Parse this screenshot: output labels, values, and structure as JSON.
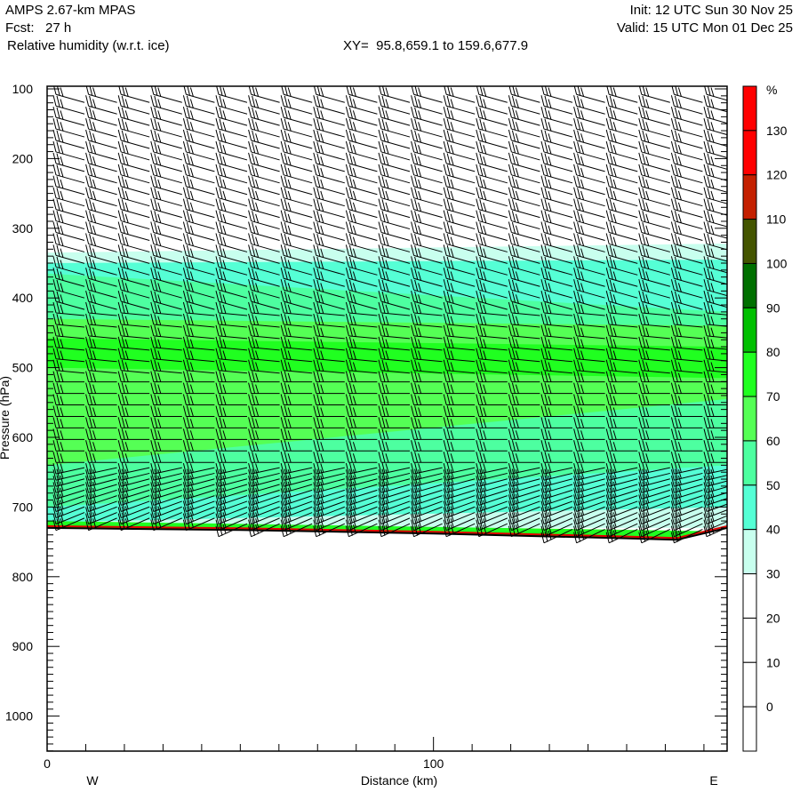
{
  "header": {
    "model": "AMPS 2.67-km MPAS",
    "forecast": "Fcst:   27 h",
    "field": "Relative humidity (w.r.t. ice)",
    "xy": "XY=  95.8,659.1 to 159.6,677.9",
    "init": "Init: 12 UTC Sun 30 Nov 25",
    "valid": "Valid: 15 UTC Mon 01 Dec 25"
  },
  "chart_data": {
    "type": "heatmap",
    "title": "Relative humidity (w.r.t. ice)",
    "xlabel": "Distance (km)",
    "ylabel": "Pressure (hPa)",
    "xlim": [
      0,
      176
    ],
    "ylim": [
      1050,
      96
    ],
    "x_ticks": [
      "0",
      "100"
    ],
    "x_tick_values": [
      0,
      100
    ],
    "y_ticks": [
      "100",
      "200",
      "300",
      "400",
      "500",
      "600",
      "700",
      "800",
      "900",
      "1000"
    ],
    "y_tick_values": [
      100,
      200,
      300,
      400,
      500,
      600,
      700,
      800,
      900,
      1000
    ],
    "west_label": "W",
    "east_label": "E",
    "colorbar": {
      "unit": "%",
      "labels": [
        "130",
        "120",
        "110",
        "100",
        "90",
        "80",
        "70",
        "60",
        "50",
        "40",
        "30",
        "20",
        "10",
        "0"
      ],
      "colors": [
        "#ff0000",
        "#ff0000",
        "#c42000",
        "#445500",
        "#007000",
        "#00c000",
        "#20ff20",
        "#55ff55",
        "#4dffa0",
        "#55ffd5",
        "#c8ffee",
        "#ffffff",
        "#ffffff",
        "#ffffff",
        "#ffffff"
      ]
    },
    "rh_layers": [
      {
        "bin": "30-40",
        "color": "#c8ffee",
        "top": [
          335,
          322
        ],
        "bottom": [
          730,
          730
        ]
      },
      {
        "bin": "40-50",
        "color": "#55ffd5",
        "top": [
          350,
          345
        ],
        "bottom": [
          722,
          700
        ]
      },
      {
        "bin": "50-60",
        "color": "#4dffa0",
        "top": [
          365,
          420
        ],
        "bottom": [
          700,
          640
        ]
      },
      {
        "bin": "60-70",
        "color": "#55ff55",
        "top": [
          430,
          440
        ],
        "bottom": [
          640,
          545
        ]
      },
      {
        "bin": "70-80",
        "color": "#20ff20",
        "top": [
          458,
          470
        ],
        "bottom": [
          500,
          515
        ]
      },
      {
        "bin": "near-surface 70-80",
        "color": "#20ff20",
        "top": [
          720,
          735
        ],
        "bottom": [
          731,
          746
        ]
      }
    ],
    "surface_pressure": {
      "x": [
        0,
        50,
        100,
        150,
        163,
        176
      ],
      "p": [
        730,
        733,
        738,
        745,
        747,
        730
      ]
    },
    "wind_barb_columns": 21
  }
}
